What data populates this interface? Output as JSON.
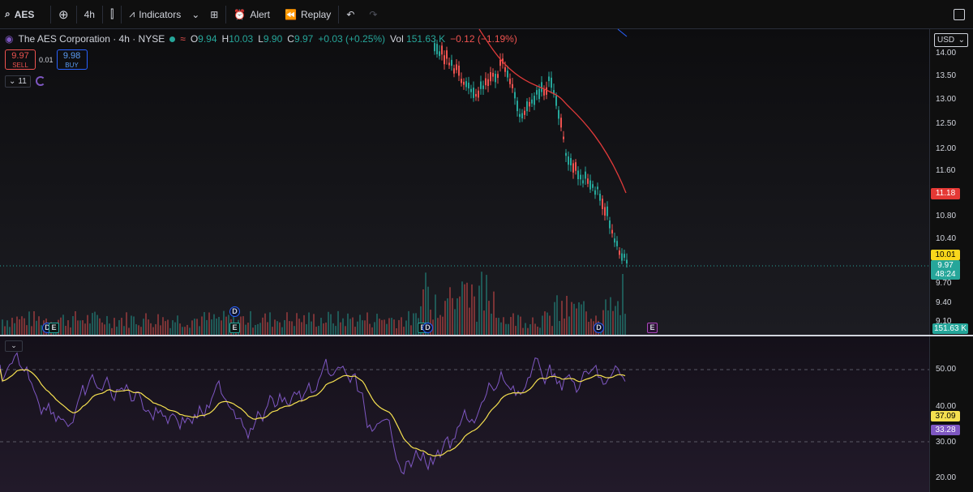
{
  "toolbar": {
    "symbol": "AES",
    "interval": "4h",
    "indicators_label": "Indicators",
    "alert_label": "Alert",
    "replay_label": "Replay"
  },
  "legend": {
    "title": "The AES Corporation · 4h · NYSE",
    "o_label": "O",
    "o": "9.94",
    "h_label": "H",
    "h": "10.03",
    "l_label": "L",
    "l": "9.90",
    "c_label": "C",
    "c": "9.97",
    "change": "+0.03 (+0.25%)",
    "vol_label": "Vol",
    "vol": "151.63 K",
    "vol_change": "−0.12 (−1.19%)"
  },
  "trade": {
    "sell_price": "9.97",
    "sell_label": "SELL",
    "spread": "0.01",
    "buy_price": "9.98",
    "buy_label": "BUY"
  },
  "indicator_count": "11",
  "currency": "USD",
  "price_axis": [
    "14.00",
    "13.50",
    "13.00",
    "12.50",
    "12.00",
    "11.60",
    "10.80",
    "10.40",
    "9.70",
    "9.40",
    "9.10"
  ],
  "rsi_axis": [
    "50.00",
    "40.00",
    "30.00",
    "20.00"
  ],
  "tags": {
    "ma_price": "11.18",
    "prev_close": "10.01",
    "last_price": "9.97",
    "countdown": "48:24",
    "volume": "151.63 K",
    "rsi_ma": "37.09",
    "rsi": "33.28"
  },
  "markers": {
    "earnings": "E",
    "dividend": "D"
  },
  "colors": {
    "up": "#26a69a",
    "down": "#ef5350",
    "ma": "#e03a3a",
    "rsi": "#7e57c2",
    "rsi_ma": "#f5e050",
    "accent": "#2962ff"
  }
}
